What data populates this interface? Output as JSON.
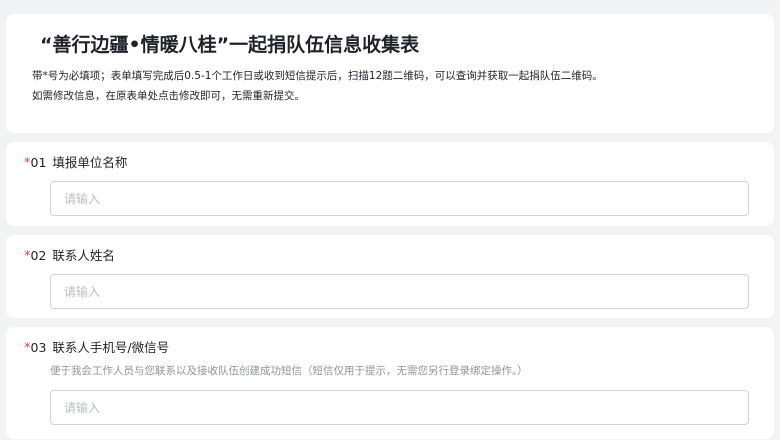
{
  "form": {
    "title": "“善行边疆•情暖八桂”一起捐队伍信息收集表",
    "description_line1": "带*号为必填项；表单填写完成后0.5-1个工作日或收到短信提示后，扫描12题二维码，可以查询并获取一起捐队伍二维码。",
    "description_line2": "如需修改信息，在原表单处点击修改即可，无需重新提交。"
  },
  "questions": [
    {
      "required_mark": "*",
      "number": "01",
      "label": "填报单位名称",
      "hint": "",
      "value": "",
      "placeholder": "请输入"
    },
    {
      "required_mark": "*",
      "number": "02",
      "label": "联系人姓名",
      "hint": "",
      "value": "",
      "placeholder": "请输入"
    },
    {
      "required_mark": "*",
      "number": "03",
      "label": "联系人手机号/微信号",
      "hint": "便于我会工作人员与您联系以及接收队伍创建成功短信（短信仅用于提示，无需您另行登录绑定操作。）",
      "value": "",
      "placeholder": "请输入"
    }
  ],
  "colors": {
    "required": "#e5443b",
    "placeholder": "#bbbfc4",
    "page_background": "#f2f3f5"
  }
}
